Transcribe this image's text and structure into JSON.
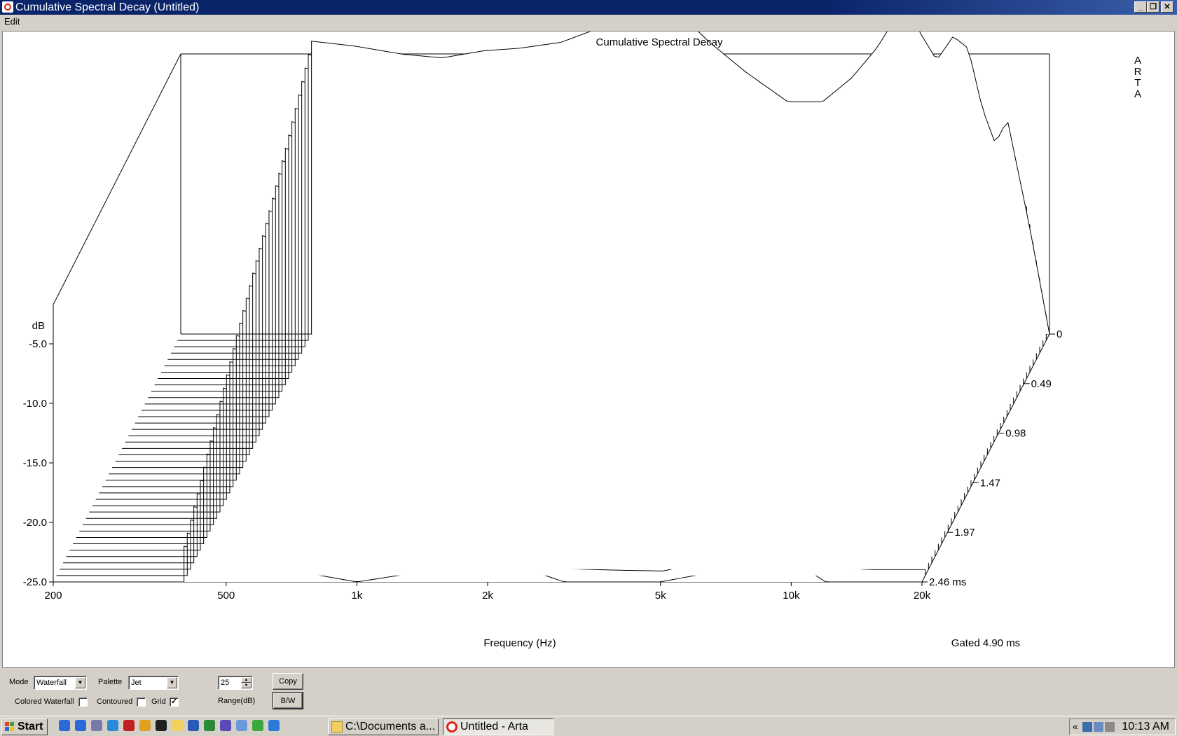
{
  "window": {
    "title": "Cumulative Spectral Decay  (Untitled)",
    "min_glyph": "_",
    "max_glyph": "❐",
    "close_glyph": "✕"
  },
  "menu": {
    "edit": "Edit"
  },
  "chart_data": {
    "type": "waterfall",
    "title": "Cumulative Spectral Decay",
    "xlabel": "Frequency (Hz)",
    "ylabel": "dB",
    "zlabel": "ms",
    "watermark": [
      "A",
      "R",
      "T",
      "A"
    ],
    "gated_note": "Gated 4.90 ms",
    "x_scale": "log",
    "xlim": [
      200,
      20000
    ],
    "x_ticks": [
      {
        "label": "200",
        "value": 200
      },
      {
        "label": "500",
        "value": 500
      },
      {
        "label": "1k",
        "value": 1000
      },
      {
        "label": "2k",
        "value": 2000
      },
      {
        "label": "5k",
        "value": 5000
      },
      {
        "label": "10k",
        "value": 10000
      },
      {
        "label": "20k",
        "value": 20000
      }
    ],
    "ylim": [
      -25,
      0
    ],
    "y_ticks": [
      "-5.0",
      "-10.0",
      "-15.0",
      "-20.0",
      "-25.0"
    ],
    "z_ticks": [
      "0",
      "0.49",
      "0.98",
      "1.47",
      "1.97",
      "2.46 ms"
    ],
    "zlim_ms": [
      0,
      2.46
    ],
    "slice_count": 40,
    "grid": true,
    "initial_spectrum": {
      "freq": [
        400,
        500,
        650,
        800,
        1000,
        1200,
        1500,
        2000,
        2500,
        2800,
        3300,
        4000,
        5000,
        6000,
        7000,
        8000,
        9000,
        9500,
        10000,
        11000,
        12000,
        13000,
        14000,
        15000,
        16000,
        18000,
        20000
      ],
      "db": [
        -0.4,
        -0.8,
        -1.5,
        -1.8,
        -1.2,
        -1.0,
        -0.5,
        1.2,
        2.5,
        2.0,
        -0.5,
        -3.0,
        -5.5,
        -5.5,
        -3.5,
        -1.0,
        2.0,
        2.8,
        0.5,
        -2.0,
        0.0,
        -1.0,
        -6.0,
        -9.0,
        -7.0,
        -16.0,
        -25.0
      ]
    },
    "decay_sample_curves": [
      {
        "time_ms": 0.49,
        "freq": [
          400,
          700,
          1000,
          1500,
          2000,
          2500,
          3000,
          4000,
          5000,
          7000,
          9000,
          12000,
          15000
        ],
        "db": [
          -5.0,
          -8.5,
          -7.5,
          -5.5,
          -4.5,
          -4.0,
          -6.0,
          -8.5,
          -10.0,
          -6.0,
          -1.0,
          -4.0,
          -9.0
        ]
      },
      {
        "time_ms": 1.47,
        "freq": [
          400,
          700,
          1000,
          1500,
          2000,
          2500,
          3000,
          4000,
          5000,
          7000,
          9000,
          12000,
          15000
        ],
        "db": [
          -13.0,
          -15.0,
          -16.0,
          -13.0,
          -12.0,
          -14.0,
          -16.0,
          -18.0,
          -19.0,
          -13.0,
          -8.0,
          -14.0,
          -17.0
        ]
      },
      {
        "time_ms": 2.46,
        "freq": [
          400,
          700,
          1000,
          1500,
          2000,
          2500,
          3000,
          4000,
          5000,
          7000,
          9000,
          12000,
          15000
        ],
        "db": [
          -22.0,
          -24.0,
          -25.0,
          -24.0,
          -23.5,
          -24.0,
          -25.0,
          -25.0,
          -25.0,
          -24.0,
          -22.0,
          -25.0,
          -25.0
        ]
      }
    ]
  },
  "controls": {
    "mode_label": "Mode",
    "mode_value": "Waterfall",
    "palette_label": "Palette",
    "palette_value": "Jet",
    "range_value": "25",
    "range_label": "Range(dB)",
    "copy_label": "Copy",
    "bw_label": "B/W",
    "colored_waterfall_label": "Colored Waterfall",
    "colored_waterfall_checked": false,
    "contoured_label": "Contoured",
    "contoured_checked": false,
    "grid_label": "Grid",
    "grid_checked": true,
    "check_glyph": "✓",
    "arrow_glyph": "▼",
    "spin_up": "▲",
    "spin_down": "▼"
  },
  "taskbar": {
    "start_label": "Start",
    "quicklaunch_icons": [
      "ie-icon",
      "ie-icon",
      "network-icon",
      "media-icon",
      "red-app-icon",
      "chrome-icon",
      "cmd-icon",
      "folder-icon",
      "word-icon",
      "excel-icon",
      "help-icon",
      "notepad-icon",
      "green-app-icon",
      "blue-app-icon"
    ],
    "tasks": [
      {
        "label": "C:\\Documents a...",
        "icon": "folder-icon",
        "active": false
      },
      {
        "label": "Untitled - Arta",
        "icon": "arta-icon",
        "active": true
      }
    ],
    "tray_chevron": "«",
    "clock": "10:13 AM"
  }
}
